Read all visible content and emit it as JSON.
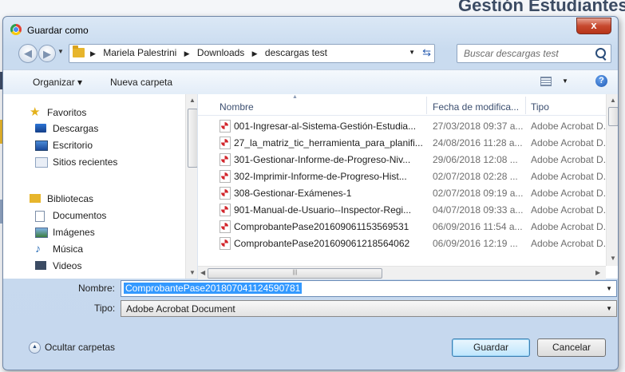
{
  "background": {
    "title": "Gestión Estudiantes"
  },
  "dialog": {
    "title": "Guardar como",
    "close_label": "x"
  },
  "address": {
    "crumbs": [
      "Mariela Palestrini",
      "Downloads",
      "descargas test"
    ],
    "search_placeholder": "Buscar descargas test"
  },
  "toolbar": {
    "organize_label": "Organizar ▾",
    "new_folder_label": "Nueva carpeta",
    "help_label": "?"
  },
  "nav": {
    "favorites": "Favoritos",
    "items": [
      "Descargas",
      "Escritorio",
      "Sitios recientes"
    ],
    "libraries": "Bibliotecas",
    "lib_items": [
      "Documentos",
      "Imágenes",
      "Música",
      "Videos"
    ]
  },
  "columns": {
    "name": "Nombre",
    "date": "Fecha de modifica...",
    "type": "Tipo"
  },
  "files": [
    {
      "name": "001-Ingresar-al-Sistema-Gestión-Estudia...",
      "date": "27/03/2018 09:37 a...",
      "type": "Adobe Acrobat D..."
    },
    {
      "name": "27_la_matriz_tic_herramienta_para_planifi...",
      "date": "24/08/2016 11:28 a...",
      "type": "Adobe Acrobat D..."
    },
    {
      "name": "301-Gestionar-Informe-de-Progreso-Niv...",
      "date": "29/06/2018 12:08 ...",
      "type": "Adobe Acrobat D..."
    },
    {
      "name": "302-Imprimir-Informe-de-Progreso-Hist...",
      "date": "02/07/2018 02:28 ...",
      "type": "Adobe Acrobat D..."
    },
    {
      "name": "308-Gestionar-Exámenes-1",
      "date": "02/07/2018 09:19 a...",
      "type": "Adobe Acrobat D..."
    },
    {
      "name": "901-Manual-de-Usuario--Inspector-Regi...",
      "date": "04/07/2018 09:33 a...",
      "type": "Adobe Acrobat D..."
    },
    {
      "name": "ComprobantePase201609061153569531",
      "date": "06/09/2016 11:54 a...",
      "type": "Adobe Acrobat D..."
    },
    {
      "name": "ComprobantePase201609061218564062",
      "date": "06/09/2016 12:19 ...",
      "type": "Adobe Acrobat D..."
    }
  ],
  "form": {
    "name_label": "Nombre:",
    "name_value": "ComprobantePase20180704112459078​1",
    "type_label": "Tipo:",
    "type_value": "Adobe Acrobat Document"
  },
  "footer": {
    "hide_folders_label": "Ocultar carpetas",
    "save_label": "Guardar",
    "cancel_label": "Cancelar"
  }
}
